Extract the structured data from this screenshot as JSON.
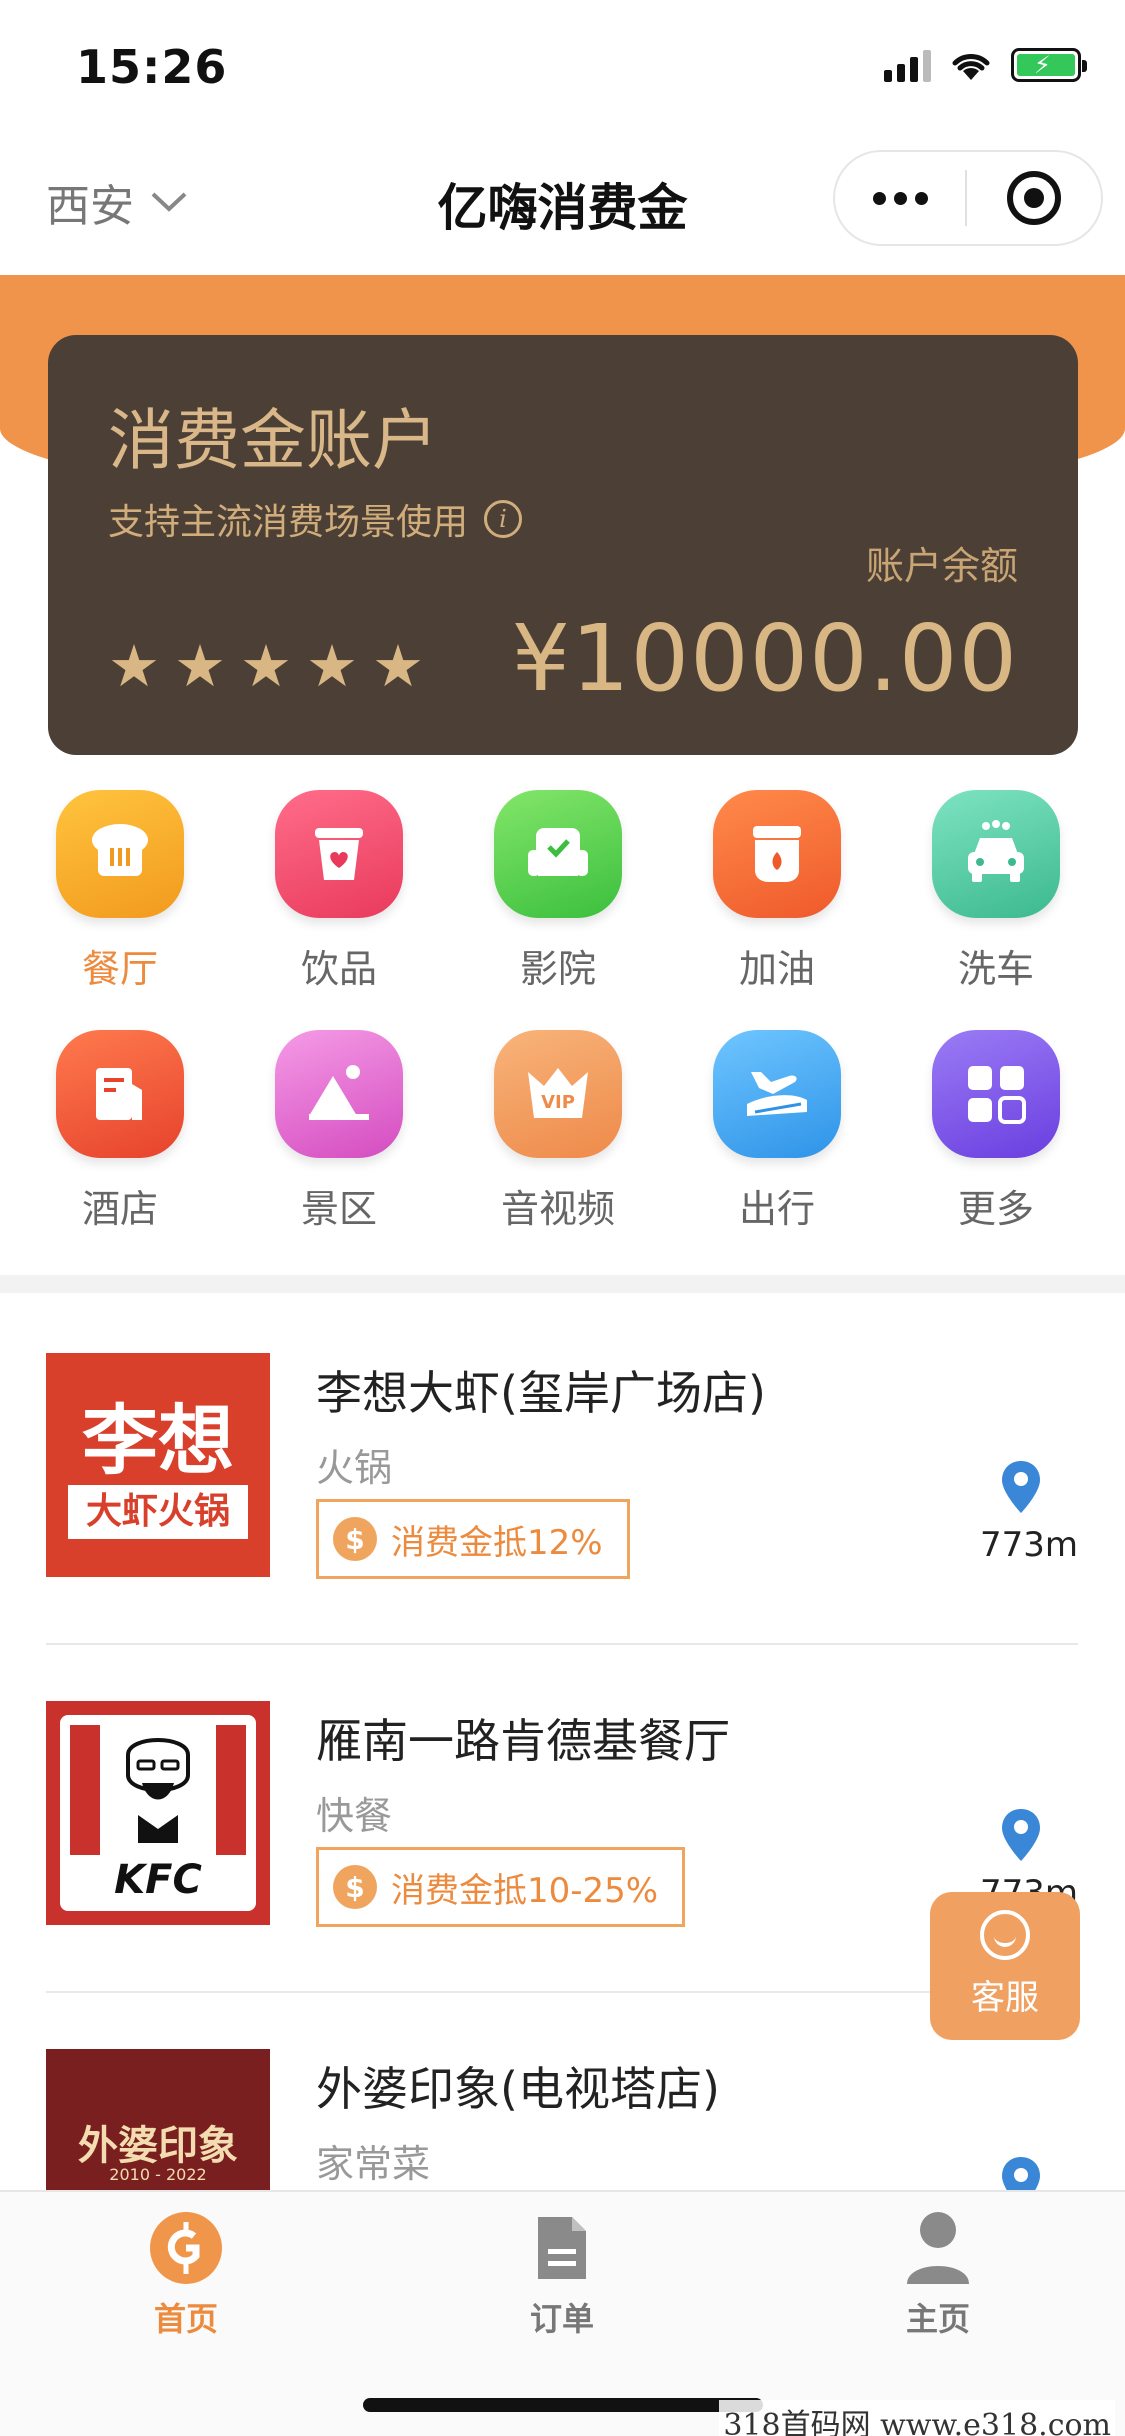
{
  "status_bar": {
    "time": "15:26"
  },
  "nav": {
    "city": "西安",
    "title": "亿嗨消费金"
  },
  "account_card": {
    "title": "消费金账户",
    "subtitle": "支持主流消费场景使用",
    "balance_label": "账户余额",
    "balance_value": "¥10000.00",
    "stars": 5
  },
  "categories": [
    {
      "label": "餐厅",
      "icon": "restaurant-icon",
      "color": "#f6a22a",
      "active": true
    },
    {
      "label": "饮品",
      "icon": "drink-icon",
      "color": "#ee4f6e"
    },
    {
      "label": "影院",
      "icon": "cinema-icon",
      "color": "#5fd157"
    },
    {
      "label": "加油",
      "icon": "fuel-icon",
      "color": "#f26a3a"
    },
    {
      "label": "洗车",
      "icon": "car-wash-icon",
      "color": "#4fcaa0"
    },
    {
      "label": "酒店",
      "icon": "hotel-icon",
      "color": "#ee5a3c"
    },
    {
      "label": "景区",
      "icon": "scenic-icon",
      "color": "#e463c8"
    },
    {
      "label": "音视频",
      "icon": "vip-media-icon",
      "color": "#f09a5c"
    },
    {
      "label": "出行",
      "icon": "travel-icon",
      "color": "#40a4ee"
    },
    {
      "label": "更多",
      "icon": "more-grid-icon",
      "color": "#8058e8"
    }
  ],
  "stores": [
    {
      "name": "李想大虾(玺岸广场店)",
      "cuisine": "火锅",
      "discount": "消费金抵12%",
      "distance": "773m",
      "logo_text_1": "李想",
      "logo_text_2": "大虾火锅"
    },
    {
      "name": "雁南一路肯德基餐厅",
      "cuisine": "快餐",
      "discount": "消费金抵10-25%",
      "distance": "773m",
      "logo_text": "KFC"
    },
    {
      "name": "外婆印象(电视塔店)",
      "cuisine": "家常菜",
      "logo_text": "外婆印象",
      "logo_years": "2010 - 2022"
    }
  ],
  "service_button": {
    "label": "客服"
  },
  "tabbar": [
    {
      "label": "首页",
      "icon": "home-coin-icon",
      "active": true
    },
    {
      "label": "订单",
      "icon": "order-document-icon"
    },
    {
      "label": "主页",
      "icon": "profile-user-icon"
    }
  ],
  "watermark": "318首码网 www.e318.com",
  "colors": {
    "accent": "#ec8a3d",
    "card_bg": "#4c4036",
    "card_gold": "#d8b784",
    "header_orange": "#f1944b"
  }
}
